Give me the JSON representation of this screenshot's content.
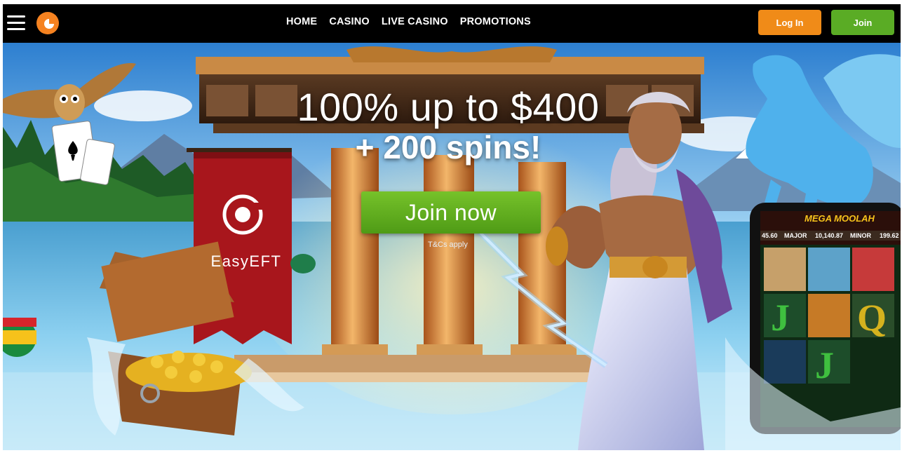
{
  "header": {
    "menu_icon": "hamburger-menu-icon",
    "logo_icon": "brand-logo-icon",
    "nav": [
      "HOME",
      "CASINO",
      "LIVE CASINO",
      "PROMOTIONS"
    ],
    "login_label": "Log In",
    "join_label": "Join"
  },
  "hero": {
    "headline_line1": "100% up to $400",
    "headline_line2": "+ 200 spins!",
    "cta_label": "Join now",
    "terms_text": "T&Cs apply",
    "banner_label": "EasyEFT",
    "slot_game": {
      "title": "MEGA MOOLAH",
      "jackpots": [
        {
          "label": "MAJOR",
          "value": "10,140.87"
        },
        {
          "label": "MINOR",
          "value": "199.62"
        }
      ],
      "left_value": "45.60"
    }
  },
  "colors": {
    "topbar": "#000000",
    "login": "#f08b18",
    "join": "#5aac25",
    "cta": "#5aac25",
    "banner": "#a8161c"
  }
}
